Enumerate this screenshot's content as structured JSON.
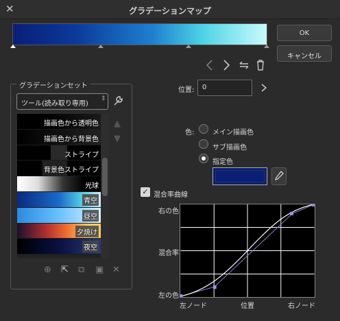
{
  "window": {
    "title": "グラデーションマップ",
    "close_glyph": "✕"
  },
  "buttons": {
    "ok": "OK",
    "cancel": "キャンセル"
  },
  "toolbar_icons": [
    "chevron-left-icon",
    "chevron-right-icon",
    "flip-icon",
    "trash-icon"
  ],
  "gradient_set": {
    "label": "グラデーションセット",
    "selected": "ツール(読み取り専用)",
    "items": [
      {
        "label": "描画色から透明色"
      },
      {
        "label": "描画色から背景色"
      },
      {
        "label": "ストライプ"
      },
      {
        "label": "背景色ストライプ"
      },
      {
        "label": "光球"
      },
      {
        "label": "青空"
      },
      {
        "label": "昼空"
      },
      {
        "label": "夕焼け"
      },
      {
        "label": "夜空"
      }
    ]
  },
  "position": {
    "label": "位置:",
    "value": "0"
  },
  "color": {
    "label": "色:",
    "options": [
      "メイン描画色",
      "サブ描画色",
      "指定色"
    ],
    "selected": "指定色",
    "swatch": "#0b1f7a"
  },
  "blend_curve": {
    "checkbox_label": "混合率曲線",
    "checked": true,
    "y_top": "右の色",
    "y_mid": "混合率",
    "y_bottom": "左の色",
    "x_left": "左ノード",
    "x_mid": "位置",
    "x_right": "右ノード"
  }
}
